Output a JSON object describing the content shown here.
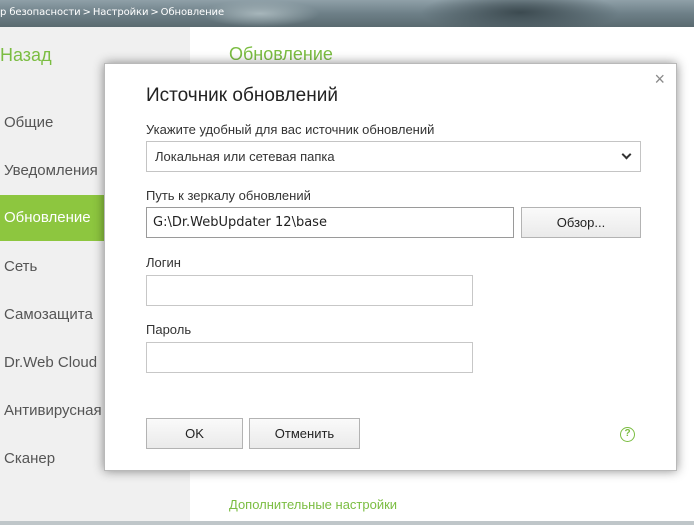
{
  "breadcrumb": {
    "items": [
      "р безопасности",
      "Настройки",
      "Обновление"
    ],
    "separator": ">"
  },
  "sidebar": {
    "back_label": "Назад",
    "items": [
      {
        "label": "Общие",
        "active": false
      },
      {
        "label": "Уведомления",
        "active": false
      },
      {
        "label": "Обновление",
        "active": true
      },
      {
        "label": "Сеть",
        "active": false
      },
      {
        "label": "Самозащита",
        "active": false
      },
      {
        "label": "Dr.Web Cloud",
        "active": false
      },
      {
        "label": "Антивирусная",
        "active": false
      },
      {
        "label": "Сканер",
        "active": false
      }
    ]
  },
  "main": {
    "title": "Обновление",
    "additional_settings_link": "Дополнительные настройки"
  },
  "dialog": {
    "title": "Источник обновлений",
    "source_label": "Укажите удобный для вас источник обновлений",
    "source_value": "Локальная или сетевая папка",
    "path_label": "Путь к зеркалу обновлений",
    "path_value": "G:\\Dr.WebUpdater 12\\base",
    "browse_label": "Обзор...",
    "login_label": "Логин",
    "login_value": "",
    "password_label": "Пароль",
    "password_value": "",
    "ok_label": "OK",
    "cancel_label": "Отменить",
    "close_glyph": "×",
    "help_glyph": "?"
  },
  "colors": {
    "accent": "#8dc63f",
    "accent_text": "#7bbd42"
  }
}
